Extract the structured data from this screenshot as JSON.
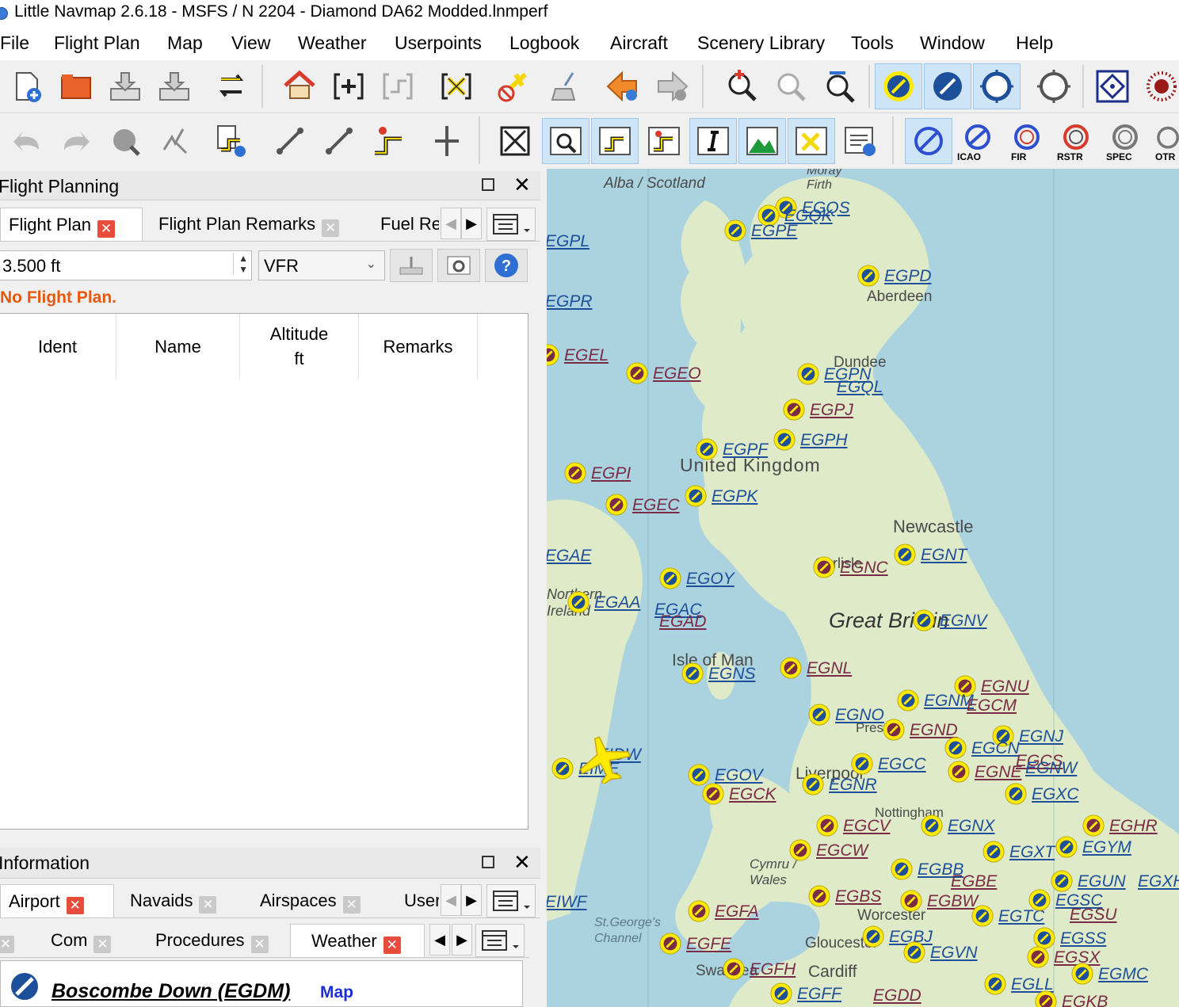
{
  "window": {
    "title": "Little Navmap 2.6.18 - MSFS / N 2204 - Diamond DA62 Modded.lnmperf"
  },
  "menu": [
    "File",
    "Flight Plan",
    "Map",
    "View",
    "Weather",
    "Userpoints",
    "Logbook",
    "Aircraft",
    "Scenery Library",
    "Tools",
    "Window",
    "Help"
  ],
  "toolbar2_labels": {
    "icao": "ICAO",
    "fir": "FIR",
    "rstr": "RSTR",
    "spec": "SPEC",
    "otr": "OTR"
  },
  "flight_planning": {
    "title": "Flight Planning",
    "tabs": [
      "Flight Plan",
      "Flight Plan Remarks",
      "Fuel Re"
    ],
    "altitude": "3.500 ft",
    "flight_rules": "VFR",
    "status": "No Flight Plan.",
    "columns": [
      "Ident",
      "Name",
      "Altitude\nft",
      "Remarks"
    ]
  },
  "information": {
    "title": "Information",
    "tabs": [
      "Airport",
      "Navaids",
      "Airspaces",
      "User"
    ],
    "subtabs": [
      "Com",
      "Procedures",
      "Weather"
    ],
    "airport_title": "Boscombe Down (EGDM)",
    "map_link": "Map"
  },
  "map": {
    "places": [
      "Alba / Scotland",
      "Moray Firth",
      "Aberdeen",
      "Dundee",
      "United Kingdom",
      "Newcastle",
      "Great Britain",
      "Isle of Man",
      "Northern Ireland",
      "Cymru / Wales",
      "St.George's Channel",
      "Worcester",
      "Gloucester",
      "Nottingham",
      "Preston",
      "Liverpool",
      "Cardiff",
      "Swansea",
      "Carlisle"
    ],
    "airports": [
      "EGQS",
      "EGQK",
      "EGPE",
      "EGPL",
      "EGPD",
      "EGPR",
      "EGEL",
      "EGEO",
      "EGPN",
      "EGQL",
      "EGPJ",
      "EGPF",
      "EGPH",
      "EGPI",
      "EGPK",
      "EGEC",
      "EGAE",
      "EGNT",
      "EGNC",
      "EGOY",
      "EGAA",
      "EGAC",
      "EGAD",
      "EGNV",
      "EGNS",
      "EGNL",
      "EGNU",
      "EGNM",
      "EGCM",
      "EGNO",
      "EGND",
      "EGNJ",
      "EGCN",
      "EGCS",
      "EIDW",
      "EIME",
      "EGOV",
      "EGCC",
      "EGNE",
      "EGNW",
      "EGNR",
      "EGCK",
      "EGXC",
      "EGHR",
      "EGCV",
      "EGNX",
      "EGCW",
      "EGXT",
      "EGYM",
      "EGBB",
      "EGBE",
      "EGUN",
      "EGXH",
      "EIWF",
      "EGFA",
      "EGBS",
      "EGBW",
      "EGTC",
      "EGSC",
      "EGSU",
      "EGFE",
      "EGBJ",
      "EGVN",
      "EGSS",
      "EGSX",
      "EGFH",
      "EGMC",
      "EGFF",
      "EGDD",
      "EGLL",
      "EGKB"
    ]
  },
  "colors": {
    "civil_airport": "#1d4f9a",
    "military_airport": "#7a2b45",
    "airport_fill": "#ffea00",
    "sea": "#aad3df",
    "land": "#dfeac9",
    "status_text": "#e8580c"
  }
}
